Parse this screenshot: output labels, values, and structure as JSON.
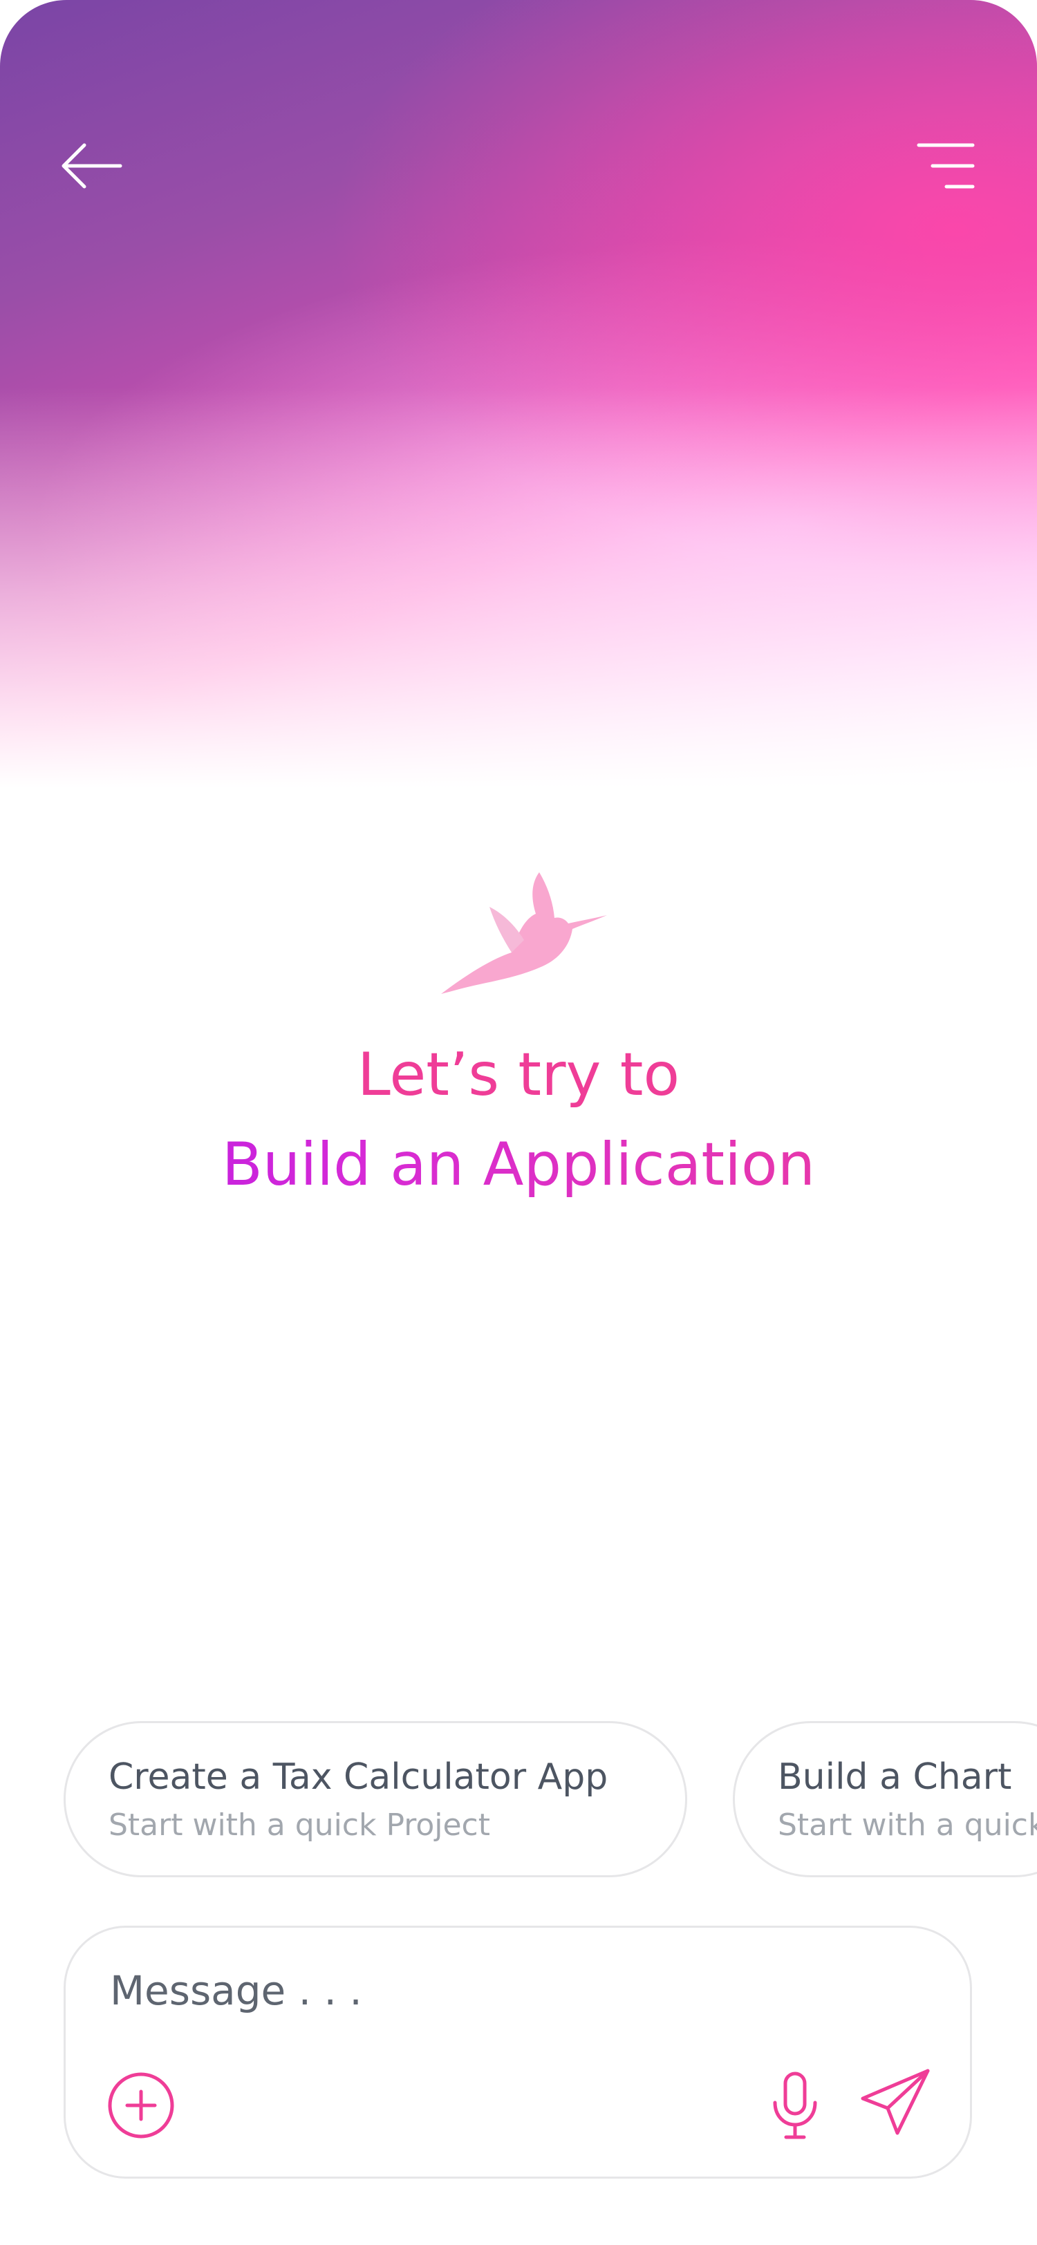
{
  "colors": {
    "accent_pink": "#ef3d97",
    "accent_purple": "#b417e6",
    "text_dark": "#4d5562",
    "text_muted": "#a2a7ae",
    "border": "#e6e6e8",
    "logo_pink": "#f9a7cf"
  },
  "header": {
    "back_icon": "arrow-left-icon",
    "menu_icon": "menu-lines-icon"
  },
  "hero": {
    "logo_icon": "hummingbird-icon",
    "headline_line1": "Let’s try to",
    "headline_line2": "Build an Application"
  },
  "suggestions": [
    {
      "title": "Create a Tax Calculator App",
      "subtitle": "Start with a quick Project"
    },
    {
      "title": "Build a Chart",
      "subtitle": "Start with a quick"
    }
  ],
  "composer": {
    "placeholder": "Message . . .",
    "add_icon": "plus-circle-icon",
    "mic_icon": "microphone-icon",
    "send_icon": "paper-plane-icon"
  }
}
